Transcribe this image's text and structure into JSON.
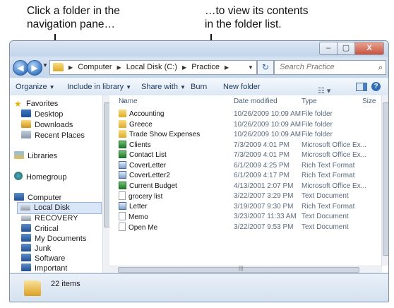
{
  "callouts": {
    "left": "Click a folder in the\nnavigation pane…",
    "right": "…to view its contents\nin the folder list."
  },
  "window": {
    "caption_buttons": [
      "–",
      "▢",
      "X"
    ],
    "address": {
      "crumbs": [
        "Computer",
        "Local Disk (C:)",
        "Practice"
      ]
    },
    "search": {
      "placeholder": "Search Practice",
      "icon": "search-icon"
    },
    "toolbar": {
      "organize": "Organize",
      "include": "Include in library",
      "share": "Share with",
      "burn": "Burn",
      "new_folder": "New folder"
    },
    "nav": {
      "favorites": "Favorites",
      "desktop": "Desktop",
      "downloads": "Downloads",
      "recent": "Recent Places",
      "libraries": "Libraries",
      "homegroup": "Homegroup",
      "computer": "Computer",
      "local_disk": "Local Disk",
      "recovery": "RECOVERY",
      "critical": "Critical",
      "my_documents": "My Documents",
      "junk": "Junk",
      "software": "Software",
      "important": "Important"
    },
    "columns": {
      "name": "Name",
      "date": "Date modified",
      "type": "Type",
      "size": "Size"
    },
    "files": [
      {
        "name": "Accounting",
        "date": "10/26/2009 10:09 AM",
        "type": "File folder",
        "icon": "folder"
      },
      {
        "name": "Greece",
        "date": "10/26/2009 10:09 AM",
        "type": "File folder",
        "icon": "folder"
      },
      {
        "name": "Trade Show Expenses",
        "date": "10/26/2009 10:09 AM",
        "type": "File folder",
        "icon": "folder"
      },
      {
        "name": "Clients",
        "date": "7/3/2009 4:01 PM",
        "type": "Microsoft Office Ex...",
        "icon": "excel"
      },
      {
        "name": "Contact List",
        "date": "7/3/2009 4:01 PM",
        "type": "Microsoft Office Ex...",
        "icon": "excel"
      },
      {
        "name": "CoverLetter",
        "date": "6/1/2009 4:25 PM",
        "type": "Rich Text Format",
        "icon": "rtf"
      },
      {
        "name": "CoverLetter2",
        "date": "6/1/2009 4:17 PM",
        "type": "Rich Text Format",
        "icon": "rtf"
      },
      {
        "name": "Current Budget",
        "date": "4/13/2001 2:07 PM",
        "type": "Microsoft Office Ex...",
        "icon": "excel"
      },
      {
        "name": "grocery list",
        "date": "3/22/2007 3:29 PM",
        "type": "Text Document",
        "icon": "text"
      },
      {
        "name": "Letter",
        "date": "3/19/2007 9:30 PM",
        "type": "Rich Text Format",
        "icon": "rtf"
      },
      {
        "name": "Memo",
        "date": "3/23/2007 11:33 AM",
        "type": "Text Document",
        "icon": "text"
      },
      {
        "name": "Open Me",
        "date": "3/22/2007 9:53 PM",
        "type": "Text Document",
        "icon": "text"
      }
    ],
    "status": {
      "count": "22 items"
    }
  }
}
